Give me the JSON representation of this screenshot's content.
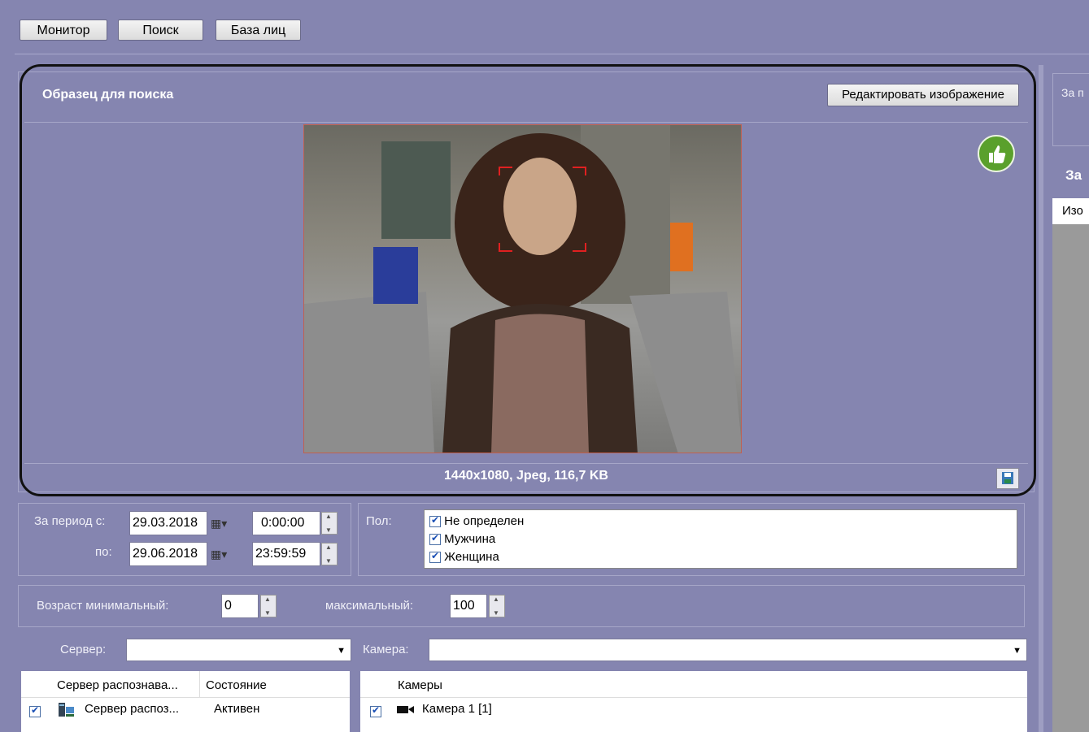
{
  "top_buttons": [
    "Монитор",
    "Поиск",
    "База лиц"
  ],
  "sample": {
    "title": "Образец для поиска",
    "edit_button": "Редактировать изображение",
    "info": "1440x1080, Jpeg, 116,7 KB"
  },
  "period": {
    "from_label": "За период с:",
    "to_label": "по:",
    "from_date": "29.03.2018",
    "from_time": "0:00:00",
    "to_date": "29.06.2018",
    "to_time": "23:59:59"
  },
  "gender": {
    "label": "Пол:",
    "options": [
      "Не определен",
      "Мужчина",
      "Женщина"
    ]
  },
  "age": {
    "min_label": "Возраст минимальный:",
    "min_value": "0",
    "max_label": "максимальный:",
    "max_value": "100"
  },
  "server": {
    "label": "Сервер:",
    "value": ""
  },
  "camera": {
    "label": "Камера:",
    "value": ""
  },
  "servers_table": {
    "columns": [
      "Сервер распознава...",
      "Состояние"
    ],
    "rows": [
      {
        "name": "Сервер распоз...",
        "status": "Активен"
      }
    ]
  },
  "cameras_table": {
    "columns": [
      "Камеры"
    ],
    "rows": [
      {
        "name": "Камера 1 [1]"
      }
    ]
  },
  "right_panel": {
    "top_text": "За п",
    "heading": "За",
    "column": "Изо"
  }
}
